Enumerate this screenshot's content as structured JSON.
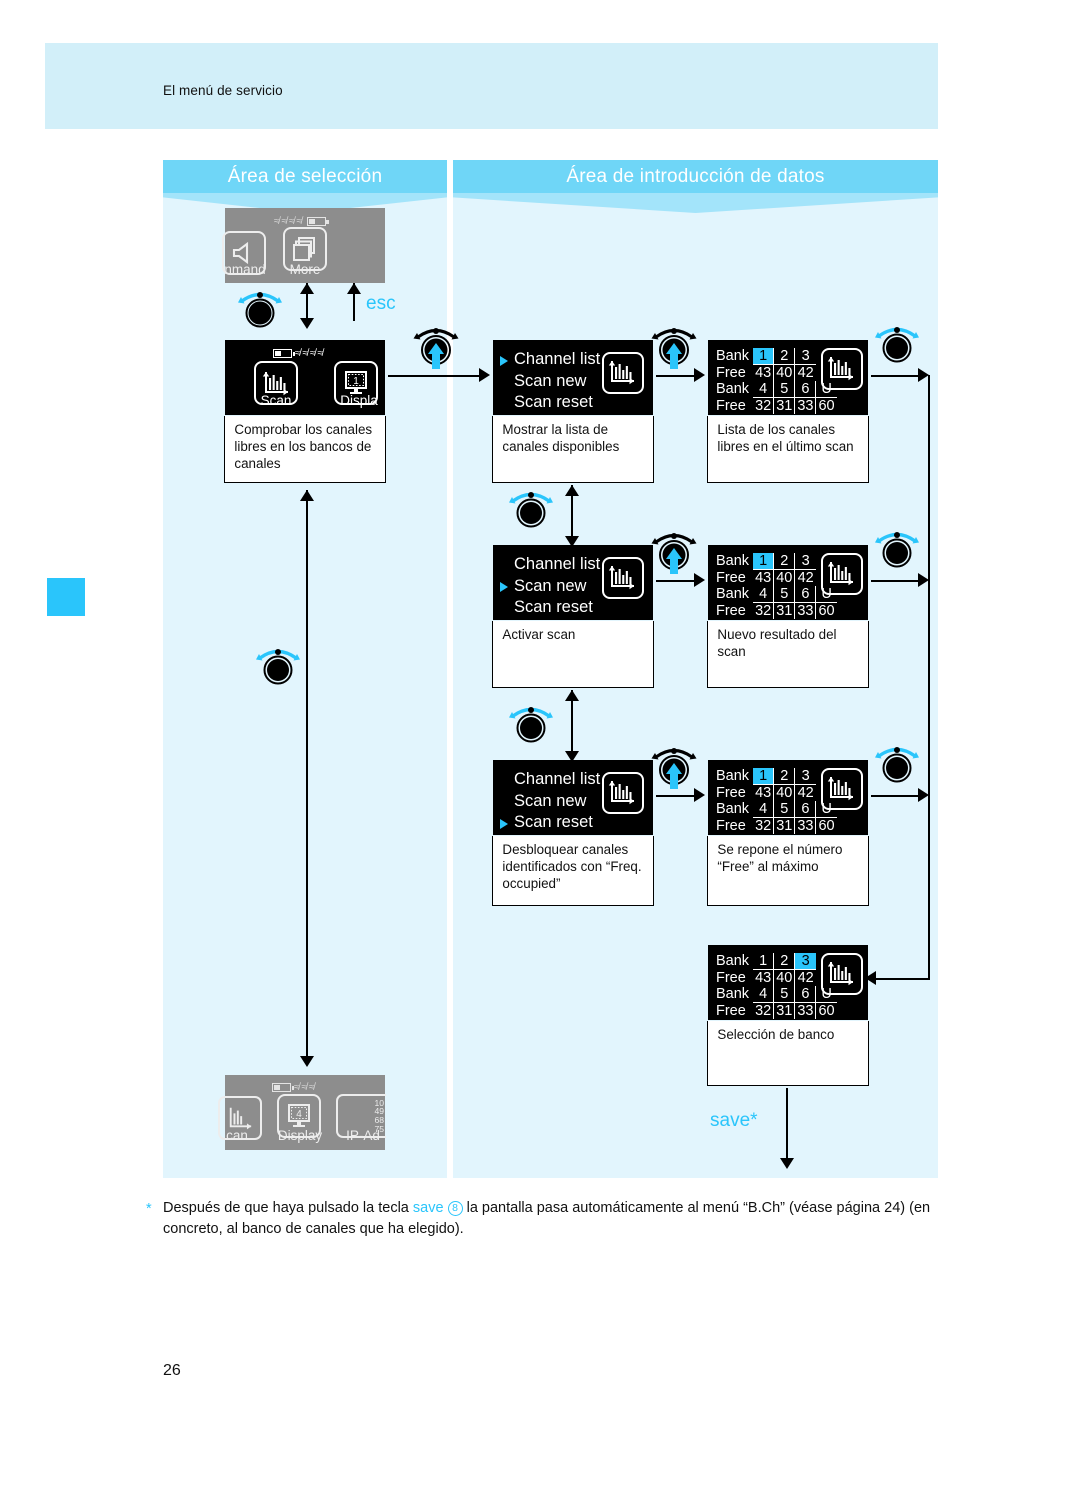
{
  "page": {
    "breadcrumb": "El menú de servicio",
    "number": "26"
  },
  "columns": {
    "left_title": "Área de selección",
    "right_title": "Área de introducción de datos"
  },
  "controls": {
    "esc_label": "esc",
    "save_label": "save*",
    "jog_turn_icon": "jog-wheel-turn-icon",
    "jog_press_icon": "jog-wheel-press-icon"
  },
  "screens": {
    "top_inactive": {
      "tiles": [
        {
          "label": "nmand",
          "icon": "speaker-icon"
        },
        {
          "label": "More",
          "icon": "stacked-pages-icon"
        }
      ],
      "status": {
        "battery": "battery-icon",
        "rf": "rf-bars-icon"
      }
    },
    "scan_home": {
      "tiles": [
        {
          "label": "Scan",
          "icon": "scan-chart-icon"
        },
        {
          "label": "Displa",
          "icon": "display-1-icon"
        }
      ],
      "caption": "Comprobar los canales libres en los bancos de canales",
      "status": {
        "battery": "battery-icon",
        "rf": "rf-bars-icon"
      }
    },
    "bottom_inactive": {
      "tiles": [
        {
          "label": "can",
          "icon": "scan-chart-icon"
        },
        {
          "label": "Display",
          "icon": "display-4-icon"
        },
        {
          "label": "IP-Ad",
          "icon": "ip-address-icon"
        }
      ],
      "ip_lines": [
        "10",
        "49",
        "68",
        "75"
      ],
      "status": {
        "battery": "battery-icon",
        "rf": "rf-bars-icon"
      }
    },
    "menu_rows": [
      {
        "items": [
          "Channel list",
          "Scan new",
          "Scan reset"
        ],
        "selected_index": 0,
        "caption": "Mostrar la lista de canales disponibles",
        "icon": "scan-chart-icon"
      },
      {
        "items": [
          "Channel list",
          "Scan new",
          "Scan reset"
        ],
        "selected_index": 1,
        "caption": "Activar scan",
        "icon": "scan-chart-icon"
      },
      {
        "items": [
          "Channel list",
          "Scan new",
          "Scan reset"
        ],
        "selected_index": 2,
        "caption": "Desbloquear canales identificados con “Freq. occupied”",
        "icon": "scan-chart-icon"
      }
    ],
    "bank_rows": [
      {
        "labels": {
          "bank": "Bank",
          "free": "Free"
        },
        "row1_banks": [
          "1",
          "2",
          "3"
        ],
        "row1_free": [
          "43",
          "40",
          "42"
        ],
        "row2_banks": [
          "4",
          "5",
          "6",
          "U"
        ],
        "row2_free": [
          "32",
          "31",
          "33",
          "60"
        ],
        "highlight": "1",
        "caption": "Lista de los canales libres en el último scan",
        "icon": "scan-chart-icon"
      },
      {
        "labels": {
          "bank": "Bank",
          "free": "Free"
        },
        "row1_banks": [
          "1",
          "2",
          "3"
        ],
        "row1_free": [
          "43",
          "40",
          "42"
        ],
        "row2_banks": [
          "4",
          "5",
          "6",
          "U"
        ],
        "row2_free": [
          "32",
          "31",
          "33",
          "60"
        ],
        "highlight": "1",
        "caption": "Nuevo resultado del scan",
        "icon": "scan-chart-icon"
      },
      {
        "labels": {
          "bank": "Bank",
          "free": "Free"
        },
        "row1_banks": [
          "1",
          "2",
          "3"
        ],
        "row1_free": [
          "43",
          "40",
          "42"
        ],
        "row2_banks": [
          "4",
          "5",
          "6",
          "U"
        ],
        "row2_free": [
          "32",
          "31",
          "33",
          "60"
        ],
        "highlight": "1",
        "caption": "Se repone el número “Free” al máximo",
        "icon": "scan-chart-icon"
      },
      {
        "labels": {
          "bank": "Bank",
          "free": "Free"
        },
        "row1_banks": [
          "1",
          "2",
          "3"
        ],
        "row1_free": [
          "43",
          "40",
          "42"
        ],
        "row2_banks": [
          "4",
          "5",
          "6",
          "U"
        ],
        "row2_free": [
          "32",
          "31",
          "33",
          "60"
        ],
        "highlight": "3",
        "caption": "Selección de banco",
        "icon": "scan-chart-icon"
      }
    ]
  },
  "footnote": {
    "marker": "*",
    "part1": "Después de que haya pulsado la tecla ",
    "save_word": "save",
    "circle_num": "8",
    "part2": " la pantalla pasa automáticamente al menú “B.Ch” (véase página 24) (en concreto, al banco de canales que ha elegido)."
  },
  "colors": {
    "accent": "#2ac5fb",
    "band": "#d2eff9",
    "panel": "#e2f5fd",
    "head": "#6fd6f7"
  }
}
